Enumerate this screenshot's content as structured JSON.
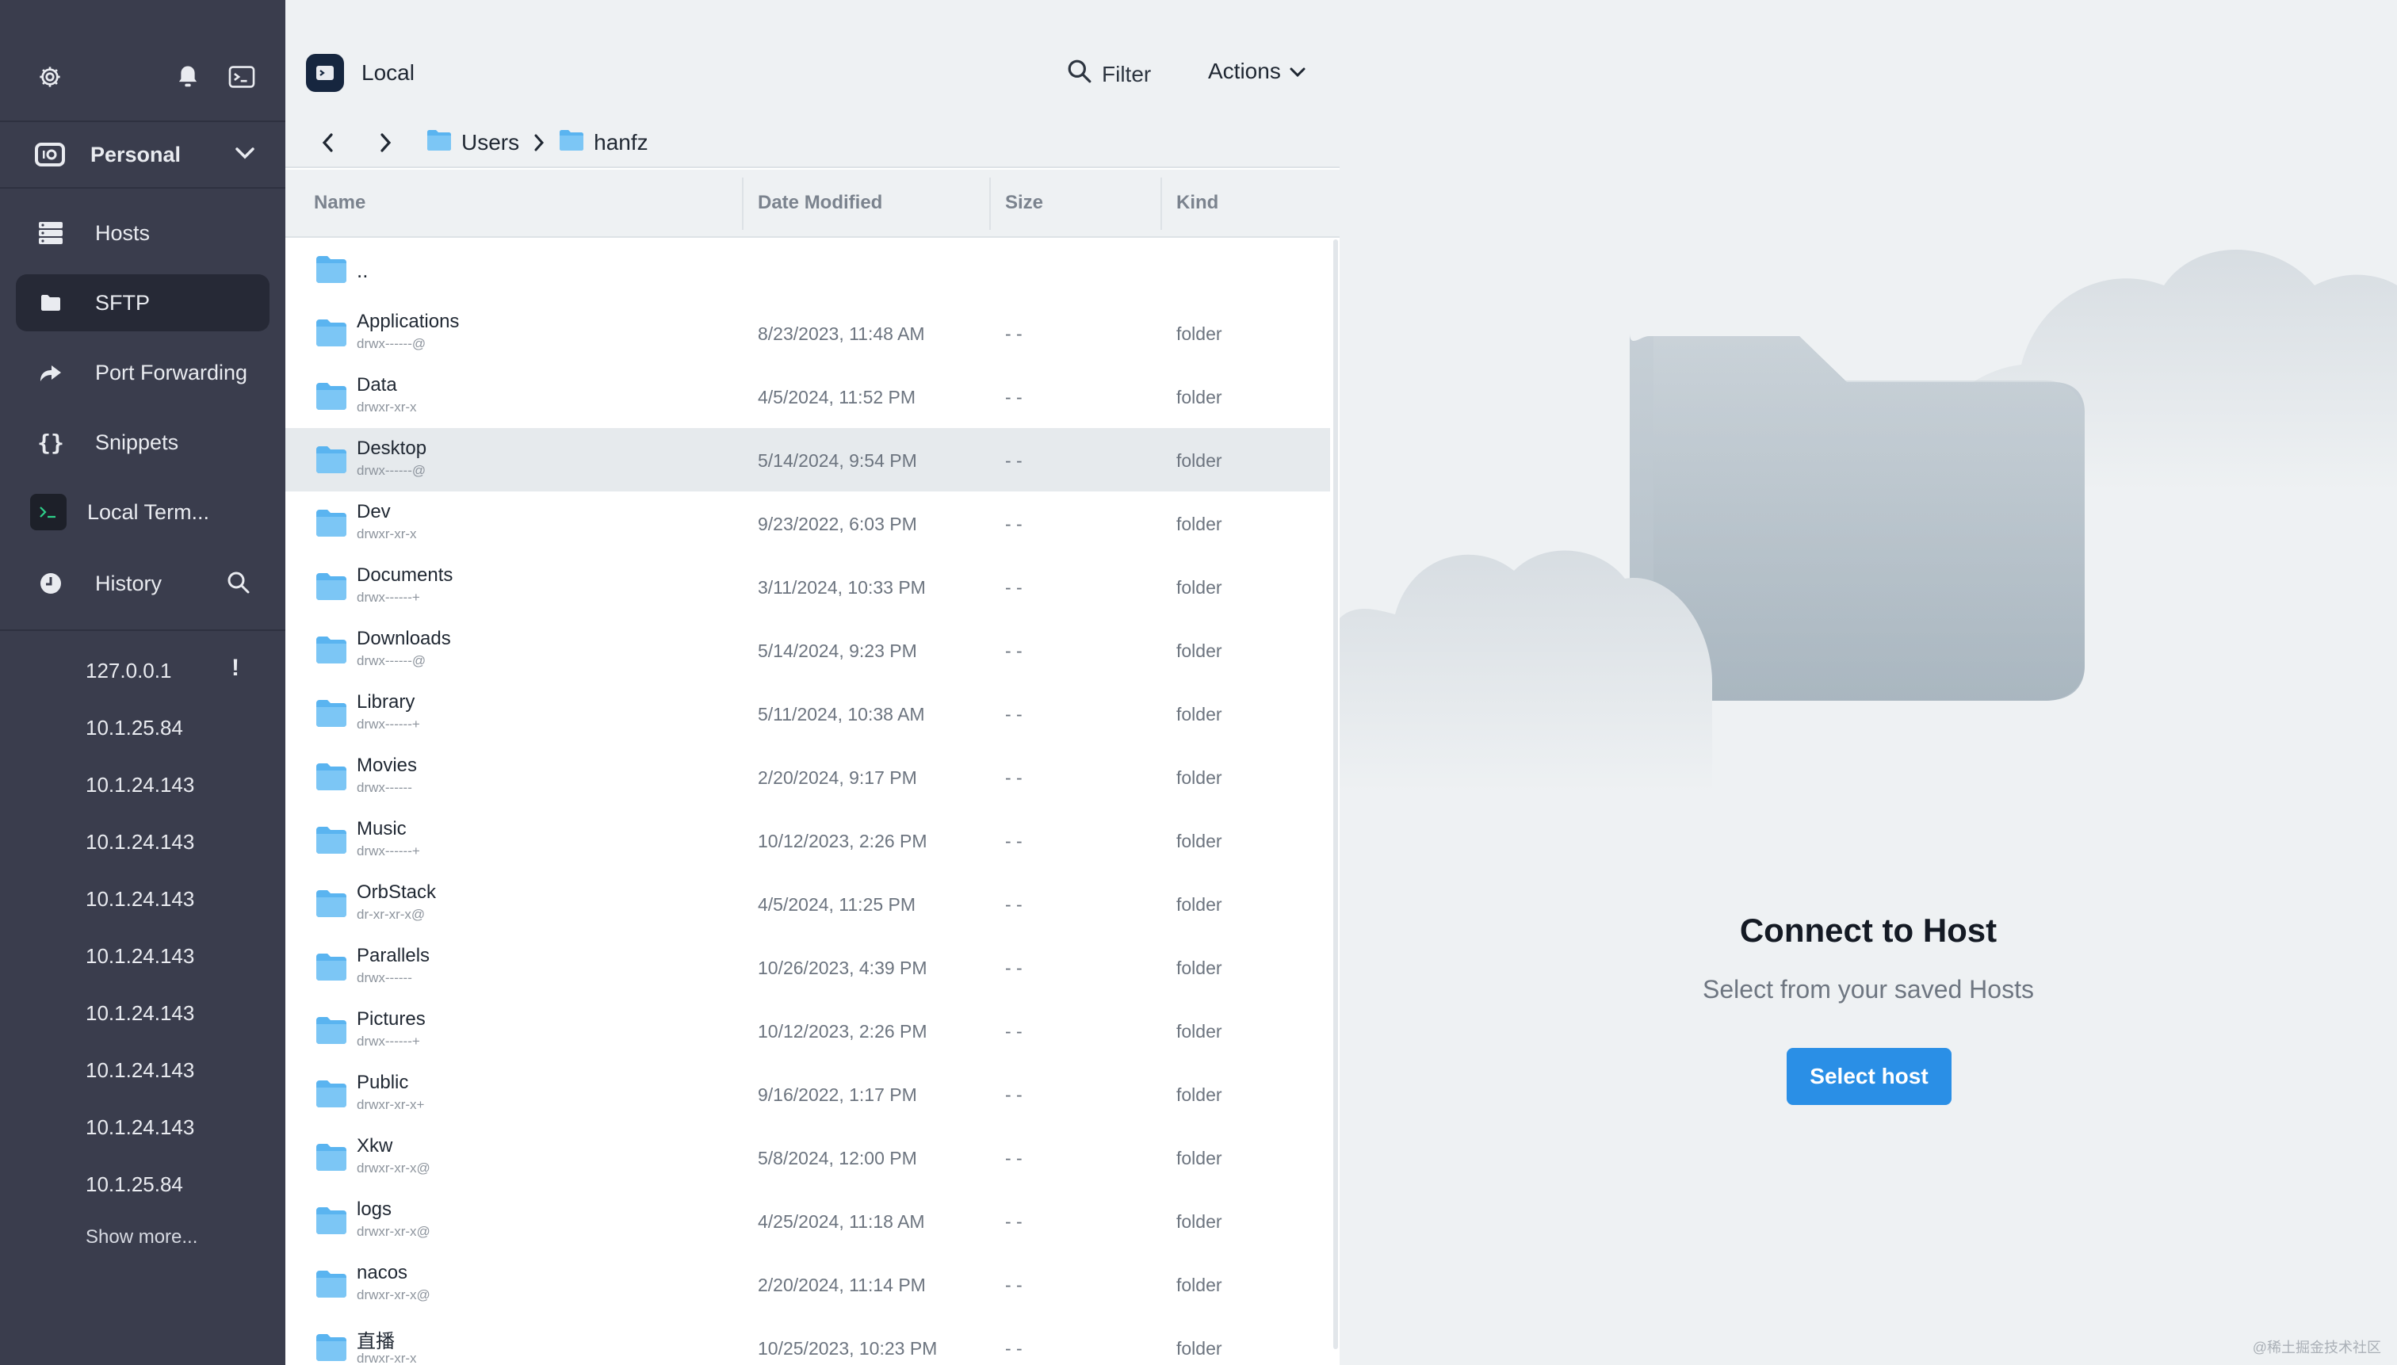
{
  "sidebar": {
    "vault_label": "Personal",
    "nav": [
      {
        "label": "Hosts",
        "icon": "hosts-icon"
      },
      {
        "label": "SFTP",
        "icon": "folder-icon",
        "active": true
      },
      {
        "label": "Port Forwarding",
        "icon": "port-forwarding-icon"
      },
      {
        "label": "Snippets",
        "icon": "braces-icon"
      },
      {
        "label": "Local Term...",
        "icon": "terminal-icon"
      }
    ],
    "history_label": "History",
    "history": [
      "127.0.0.1",
      "10.1.25.84",
      "10.1.24.143",
      "10.1.24.143",
      "10.1.24.143",
      "10.1.24.143",
      "10.1.24.143",
      "10.1.24.143",
      "10.1.24.143",
      "10.1.25.84"
    ],
    "history_warning": "!",
    "show_more": "Show more..."
  },
  "filepanel": {
    "location": "Local",
    "filter_label": "Filter",
    "actions_label": "Actions",
    "breadcrumb": [
      "Users",
      "hanfz"
    ],
    "columns": {
      "name": "Name",
      "date": "Date Modified",
      "size": "Size",
      "kind": "Kind"
    },
    "parent_label": "..",
    "rows": [
      {
        "name": "Applications",
        "perm": "drwx------@",
        "date": "8/23/2023, 11:48 AM",
        "size": "- -",
        "kind": "folder"
      },
      {
        "name": "Data",
        "perm": "drwxr-xr-x",
        "date": "4/5/2024, 11:52 PM",
        "size": "- -",
        "kind": "folder"
      },
      {
        "name": "Desktop",
        "perm": "drwx------@",
        "date": "5/14/2024, 9:54 PM",
        "size": "- -",
        "kind": "folder",
        "selected": true
      },
      {
        "name": "Dev",
        "perm": "drwxr-xr-x",
        "date": "9/23/2022, 6:03 PM",
        "size": "- -",
        "kind": "folder"
      },
      {
        "name": "Documents",
        "perm": "drwx------+",
        "date": "3/11/2024, 10:33 PM",
        "size": "- -",
        "kind": "folder"
      },
      {
        "name": "Downloads",
        "perm": "drwx------@",
        "date": "5/14/2024, 9:23 PM",
        "size": "- -",
        "kind": "folder"
      },
      {
        "name": "Library",
        "perm": "drwx------+",
        "date": "5/11/2024, 10:38 AM",
        "size": "- -",
        "kind": "folder"
      },
      {
        "name": "Movies",
        "perm": "drwx------",
        "date": "2/20/2024, 9:17 PM",
        "size": "- -",
        "kind": "folder"
      },
      {
        "name": "Music",
        "perm": "drwx------+",
        "date": "10/12/2023, 2:26 PM",
        "size": "- -",
        "kind": "folder"
      },
      {
        "name": "OrbStack",
        "perm": "dr-xr-xr-x@",
        "date": "4/5/2024, 11:25 PM",
        "size": "- -",
        "kind": "folder"
      },
      {
        "name": "Parallels",
        "perm": "drwx------",
        "date": "10/26/2023, 4:39 PM",
        "size": "- -",
        "kind": "folder"
      },
      {
        "name": "Pictures",
        "perm": "drwx------+",
        "date": "10/12/2023, 2:26 PM",
        "size": "- -",
        "kind": "folder"
      },
      {
        "name": "Public",
        "perm": "drwxr-xr-x+",
        "date": "9/16/2022, 1:17 PM",
        "size": "- -",
        "kind": "folder"
      },
      {
        "name": "Xkw",
        "perm": "drwxr-xr-x@",
        "date": "5/8/2024, 12:00 PM",
        "size": "- -",
        "kind": "folder"
      },
      {
        "name": "logs",
        "perm": "drwxr-xr-x@",
        "date": "4/25/2024, 11:18 AM",
        "size": "- -",
        "kind": "folder"
      },
      {
        "name": "nacos",
        "perm": "drwxr-xr-x@",
        "date": "2/20/2024, 11:14 PM",
        "size": "- -",
        "kind": "folder"
      },
      {
        "name": "直播",
        "perm": "drwxr-xr-x",
        "date": "10/25/2023, 10:23 PM",
        "size": "- -",
        "kind": "folder"
      }
    ]
  },
  "connect": {
    "title": "Connect to Host",
    "subtitle": "Select from your saved Hosts",
    "button_label": "Select host",
    "watermark": "@稀土掘金技术社区"
  },
  "colors": {
    "sidebar_bg": "#3a3d4d",
    "sidebar_active": "#262936",
    "folder_blue": "#5ab4f0",
    "accent": "#2a8fe6"
  }
}
